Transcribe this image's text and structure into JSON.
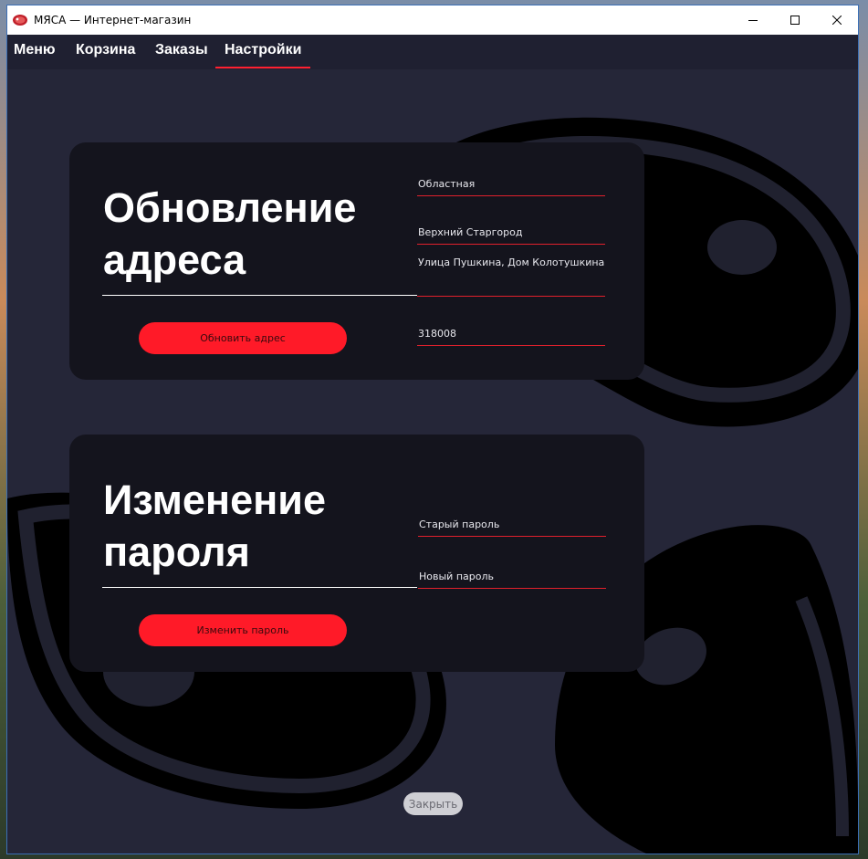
{
  "window": {
    "title": "МЯСА — Интернет-магазин",
    "controls": {
      "minimize": "—",
      "maximize": "☐",
      "close": "✕"
    }
  },
  "nav": {
    "tabs": [
      {
        "label": "Меню",
        "active": false
      },
      {
        "label": "Корзина",
        "active": false
      },
      {
        "label": "Заказы",
        "active": false
      },
      {
        "label": "Настройки",
        "active": true
      }
    ]
  },
  "address_card": {
    "title": "Обновление\nадреса",
    "button": "Обновить адрес",
    "fields": {
      "region": "Областная",
      "city": "Верхний Старгород",
      "street": "Улица Пушкина, Дом Колотушкина",
      "postcode": "318008"
    }
  },
  "password_card": {
    "title": "Изменение\nпароля",
    "button": "Изменить пароль",
    "fields": {
      "old_password_placeholder": "Старый пароль",
      "new_password_placeholder": "Новый пароль"
    }
  },
  "footer": {
    "close_button": "Закрыть"
  },
  "colors": {
    "accent": "#ff1a28",
    "background": "#252638",
    "card": "#14141d"
  },
  "icons": [
    "meat-logo-icon",
    "minimize-icon",
    "maximize-icon",
    "close-icon",
    "steak-background-art",
    "ham-background-art"
  ]
}
